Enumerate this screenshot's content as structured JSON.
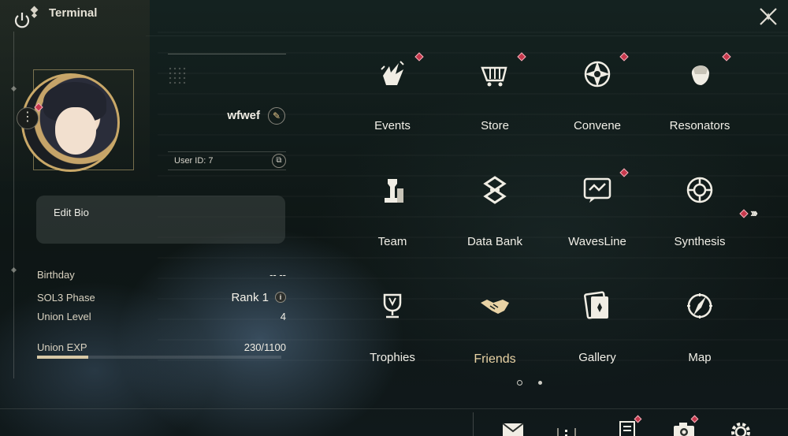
{
  "header": {
    "title": "Terminal"
  },
  "profile": {
    "username": "wfwef",
    "user_id": "User ID: 7",
    "bio_label": "Edit Bio"
  },
  "stats": {
    "birthday_label": "Birthday",
    "birthday_value": "-- --",
    "sol3_label": "SOL3 Phase",
    "sol3_value": "Rank 1",
    "union_level_label": "Union Level",
    "union_level_value": "4",
    "union_exp_label": "Union EXP",
    "union_exp_value": "230/1100",
    "union_exp_progress": 0.21
  },
  "menu": [
    {
      "label": "Events",
      "icon": "events-icon",
      "badge": true
    },
    {
      "label": "Store",
      "icon": "store-icon",
      "badge": true
    },
    {
      "label": "Convene",
      "icon": "convene-icon",
      "badge": true
    },
    {
      "label": "Resonators",
      "icon": "resonators-icon",
      "badge": true
    },
    {
      "label": "Team",
      "icon": "team-icon",
      "badge": false
    },
    {
      "label": "Data Bank",
      "icon": "data-bank-icon",
      "badge": false
    },
    {
      "label": "WavesLine",
      "icon": "wavesline-icon",
      "badge": true
    },
    {
      "label": "Synthesis",
      "icon": "synthesis-icon",
      "badge": false
    },
    {
      "label": "Trophies",
      "icon": "trophies-icon",
      "badge": false
    },
    {
      "label": "Friends",
      "icon": "friends-icon",
      "badge": false
    },
    {
      "label": "Gallery",
      "icon": "gallery-icon",
      "badge": false
    },
    {
      "label": "Map",
      "icon": "map-icon",
      "badge": false
    }
  ],
  "colors": {
    "badge": "#c7384c",
    "accent_gold": "#c9a868",
    "friends_text": "#e8d2a4"
  },
  "bottom_icons": [
    "power-icon",
    "mail-icon",
    "chat-icon",
    "notes-icon",
    "camera-icon",
    "settings-icon"
  ]
}
